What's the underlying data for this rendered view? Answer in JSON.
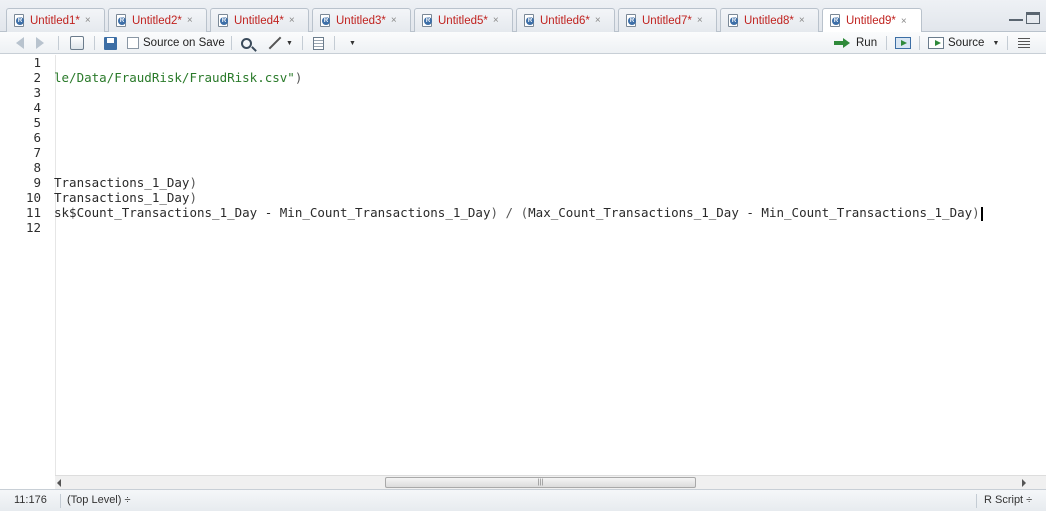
{
  "tabs": [
    {
      "label": "Untitled1*"
    },
    {
      "label": "Untitled2*"
    },
    {
      "label": "Untitled4*"
    },
    {
      "label": "Untitled3*"
    },
    {
      "label": "Untitled5*"
    },
    {
      "label": "Untitled6*"
    },
    {
      "label": "Untitled7*"
    },
    {
      "label": "Untitled8*"
    },
    {
      "label": "Untitled9*"
    }
  ],
  "tab_close_glyph": "×",
  "toolbar": {
    "source_on_save": "Source on Save",
    "run": "Run",
    "source": "Source"
  },
  "editor": {
    "line_numbers": [
      "1",
      "2",
      "3",
      "4",
      "5",
      "6",
      "7",
      "8",
      "9",
      "10",
      "11",
      "12"
    ],
    "lines": {
      "l2_str": "le/Data/FraudRisk/FraudRisk.csv\"",
      "l2_close": ")",
      "l9": "Transactions_1_Day",
      "l9_close": ")",
      "l10": "Transactions_1_Day",
      "l10_close": ")",
      "l11_a": "sk$Count_Transactions_1_Day - Min_Count_Transactions_1_Day",
      "l11_b": ") / ",
      "l11_c": "(",
      "l11_d": "Max_Count_Transactions_1_Day - Min_Count_Transactions_1_Day",
      "l11_e": ")"
    }
  },
  "status": {
    "position": "11:176",
    "scope": "(Top Level) ÷",
    "filetype": "R Script ÷"
  }
}
